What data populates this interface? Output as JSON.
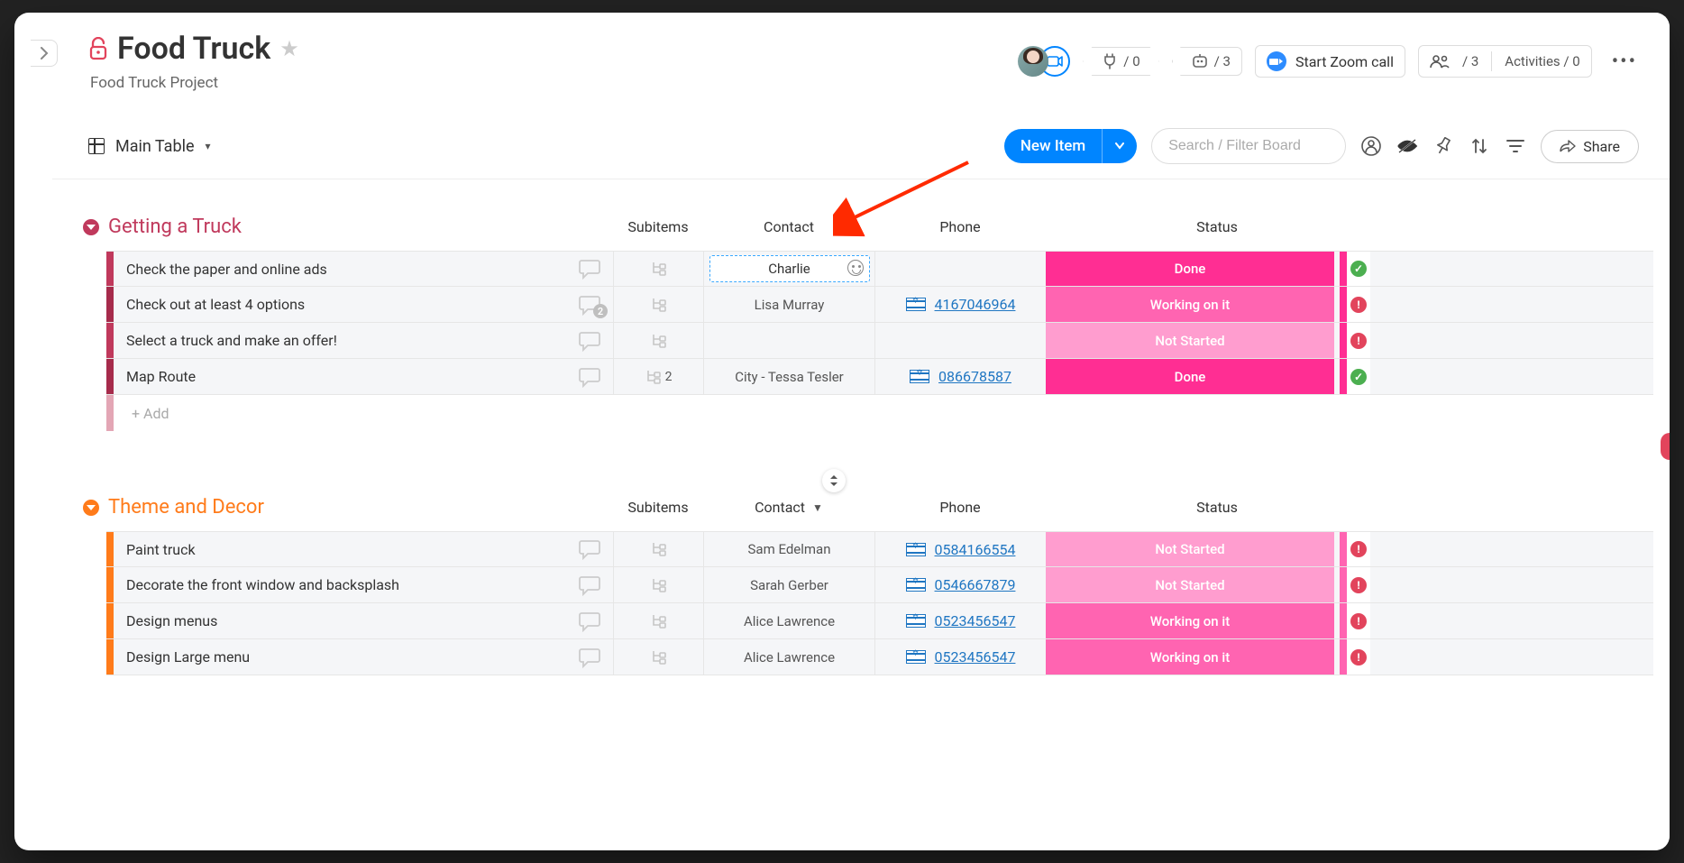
{
  "header": {
    "title": "Food Truck",
    "subtitle": "Food Truck Project",
    "integrations_count": "/ 0",
    "automations_count": "/ 3",
    "zoom_label": "Start Zoom call",
    "members_count": "/ 3",
    "activities_label": "Activities / 0"
  },
  "toolbar": {
    "view_name": "Main Table",
    "new_item_label": "New Item",
    "search_placeholder": "Search / Filter Board",
    "share_label": "Share"
  },
  "colors": {
    "group1": "#c0395c",
    "group1_accent": "#a62b4b",
    "group2": "#ff7b1a",
    "status_done": "#ff2e93",
    "status_working": "#ff64b1",
    "status_notstarted": "#ff9dcf",
    "badge_ok": "#4caf50",
    "badge_warn": "#e2445c",
    "link": "#1f76c2"
  },
  "columns": {
    "subitems": "Subitems",
    "contact": "Contact",
    "phone": "Phone",
    "status": "Status"
  },
  "groups": [
    {
      "title": "Getting a Truck",
      "color_key": "group1",
      "rows": [
        {
          "name": "Check the paper and online ads",
          "chat_count": null,
          "subitems": null,
          "contact": "Charlie",
          "editing": true,
          "phone": null,
          "status": "Done",
          "status_color": "status_done",
          "flag_color": "status_done",
          "badge": "ok"
        },
        {
          "name": "Check out at least 4 options",
          "chat_count": 2,
          "subitems": null,
          "contact": "Lisa Murray",
          "phone": "4167046964",
          "status": "Working on it",
          "status_color": "status_working",
          "flag_color": "status_done",
          "badge": "warn"
        },
        {
          "name": "Select a truck and make an offer!",
          "chat_count": null,
          "subitems": null,
          "contact": "",
          "phone": null,
          "status": "Not Started",
          "status_color": "status_notstarted",
          "flag_color": "status_done",
          "badge": "warn"
        },
        {
          "name": "Map Route",
          "chat_count": null,
          "subitems": "2",
          "contact": "City - Tessa Tesler",
          "phone": "086678587",
          "status": "Done",
          "status_color": "status_done",
          "flag_color": "status_done",
          "badge": "ok"
        }
      ],
      "add_label": "+ Add"
    },
    {
      "title": "Theme and Decor",
      "color_key": "group2",
      "show_col_menu": true,
      "rows": [
        {
          "name": "Paint truck",
          "contact": "Sam Edelman",
          "phone": "0584166554",
          "status": "Not Started",
          "status_color": "status_notstarted",
          "flag_color": "status_working",
          "badge": "warn"
        },
        {
          "name": "Decorate the front window and backsplash",
          "contact": "Sarah Gerber",
          "phone": "0546667879",
          "status": "Not Started",
          "status_color": "status_notstarted",
          "flag_color": "status_working",
          "badge": "warn"
        },
        {
          "name": "Design menus",
          "contact": "Alice Lawrence",
          "phone": "0523456547",
          "status": "Working on it",
          "status_color": "status_working",
          "flag_color": "status_working",
          "badge": "warn"
        },
        {
          "name": "Design Large menu",
          "contact": "Alice Lawrence",
          "phone": "0523456547",
          "status": "Working on it",
          "status_color": "status_working",
          "flag_color": "status_working",
          "badge": "warn"
        }
      ]
    }
  ]
}
